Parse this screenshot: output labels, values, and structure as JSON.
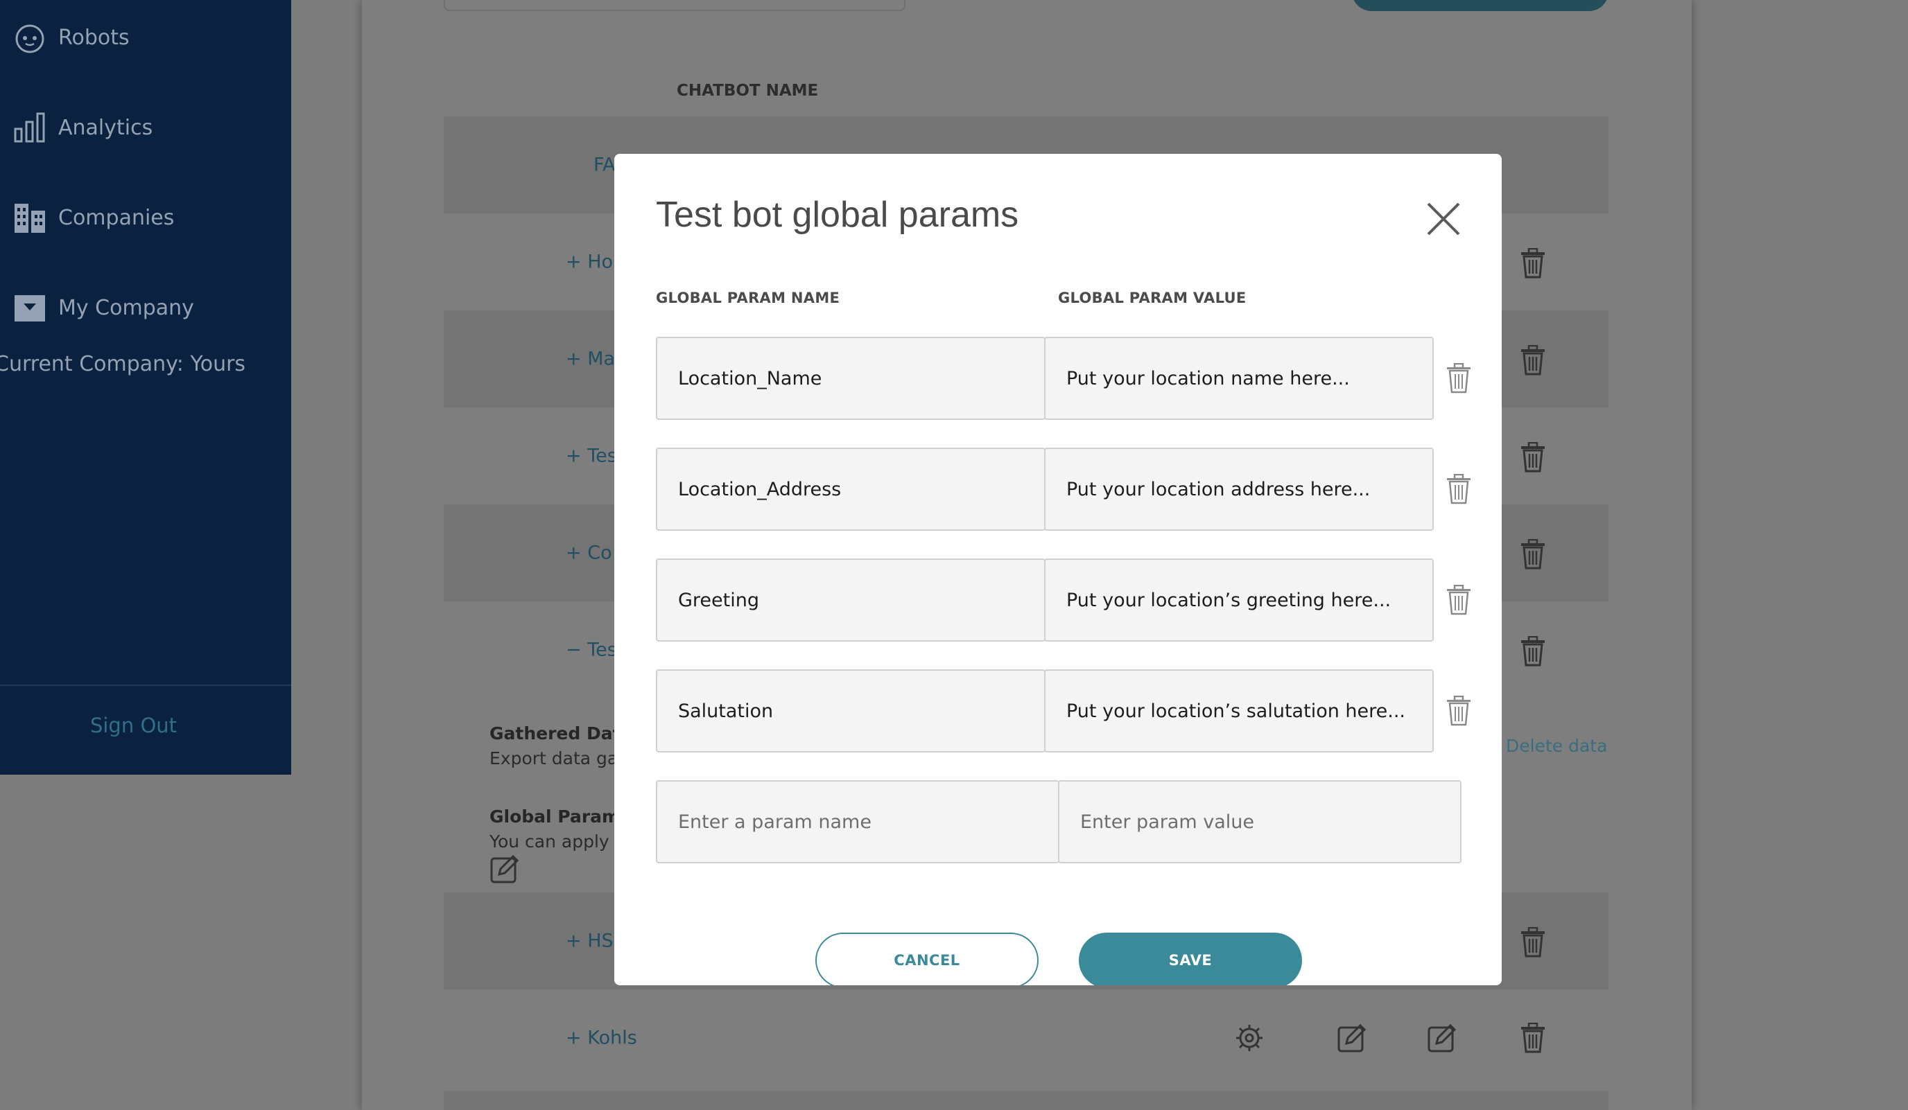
{
  "sidebar": {
    "items": [
      {
        "label": "Robots",
        "icon": "robot-icon"
      },
      {
        "label": "Analytics",
        "icon": "bar-chart-icon"
      },
      {
        "label": "Companies",
        "icon": "building-icon"
      },
      {
        "label": "My Company",
        "icon": "folder-icon"
      }
    ],
    "current_company": "Current Company: Yours",
    "sign_out": "Sign Out"
  },
  "table": {
    "column_header": "CHATBOT NAME",
    "rows": [
      {
        "prefix": "",
        "label": "FA"
      },
      {
        "prefix": "+",
        "label": "Ho"
      },
      {
        "prefix": "+",
        "label": "Ma"
      },
      {
        "prefix": "+",
        "label": "Tes"
      },
      {
        "prefix": "+",
        "label": "Co"
      },
      {
        "prefix": "−",
        "label": "Tes"
      }
    ],
    "details": {
      "gathered_data_title": "Gathered Data",
      "gathered_data_desc": "Export data gath",
      "global_params_title": "Global Paramete",
      "global_params_desc": "You can apply th",
      "delete_data": "Delete data"
    },
    "rows_after": [
      {
        "prefix": "+",
        "label": "HS"
      },
      {
        "prefix": "+",
        "label": "Kohls"
      }
    ]
  },
  "modal": {
    "title": "Test bot global params",
    "col_name": "GLOBAL PARAM NAME",
    "col_value": "GLOBAL PARAM VALUE",
    "params": [
      {
        "name": "Location_Name",
        "value": "Put your location name here..."
      },
      {
        "name": "Location_Address",
        "value": "Put your location address here..."
      },
      {
        "name": "Greeting",
        "value": "Put your location’s greeting here..."
      },
      {
        "name": "Salutation",
        "value": "Put your location’s salutation here..."
      }
    ],
    "new_name_placeholder": "Enter a param name",
    "new_value_placeholder": "Enter param value",
    "cancel_label": "CANCEL",
    "save_label": "SAVE"
  },
  "colors": {
    "sidebar_bg": "#0a223f",
    "accent": "#3b8a9a",
    "overlay_bg": "#7d7d7d"
  }
}
